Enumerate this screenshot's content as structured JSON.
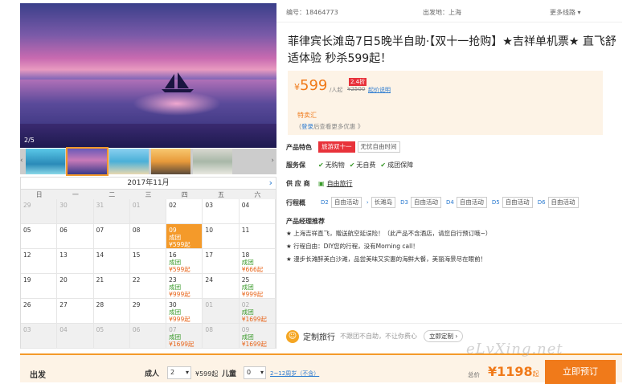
{
  "gallery": {
    "counter": "2/5"
  },
  "calendar": {
    "month": "2017年11月",
    "next": "›",
    "weekdays": [
      "日",
      "一",
      "二",
      "三",
      "四",
      "五",
      "六"
    ],
    "cells": [
      {
        "d": "29",
        "s": "grey"
      },
      {
        "d": "30",
        "s": "grey"
      },
      {
        "d": "31",
        "s": "grey"
      },
      {
        "d": "01",
        "s": "grey"
      },
      {
        "d": "02",
        "s": ""
      },
      {
        "d": "03",
        "s": ""
      },
      {
        "d": "04",
        "s": ""
      },
      {
        "d": "05",
        "s": ""
      },
      {
        "d": "06",
        "s": ""
      },
      {
        "d": "07",
        "s": ""
      },
      {
        "d": "08",
        "s": ""
      },
      {
        "d": "09",
        "s": "sel",
        "g": "成团",
        "p": "¥599起"
      },
      {
        "d": "10",
        "s": ""
      },
      {
        "d": "11",
        "s": ""
      },
      {
        "d": "12",
        "s": ""
      },
      {
        "d": "13",
        "s": ""
      },
      {
        "d": "14",
        "s": ""
      },
      {
        "d": "15",
        "s": ""
      },
      {
        "d": "16",
        "s": "",
        "g": "成团",
        "p": "¥599起"
      },
      {
        "d": "17",
        "s": ""
      },
      {
        "d": "18",
        "s": "",
        "g": "成团",
        "p": "¥666起"
      },
      {
        "d": "19",
        "s": ""
      },
      {
        "d": "20",
        "s": ""
      },
      {
        "d": "21",
        "s": ""
      },
      {
        "d": "22",
        "s": ""
      },
      {
        "d": "23",
        "s": "",
        "g": "成团",
        "p": "¥999起"
      },
      {
        "d": "24",
        "s": ""
      },
      {
        "d": "25",
        "s": "",
        "g": "成团",
        "p": "¥999起"
      },
      {
        "d": "26",
        "s": ""
      },
      {
        "d": "27",
        "s": ""
      },
      {
        "d": "28",
        "s": ""
      },
      {
        "d": "29",
        "s": ""
      },
      {
        "d": "30",
        "s": "",
        "g": "成团",
        "p": "¥999起"
      },
      {
        "d": "01",
        "s": "grey"
      },
      {
        "d": "02",
        "s": "grey",
        "g": "成团",
        "p": "¥1699起"
      },
      {
        "d": "03",
        "s": "grey"
      },
      {
        "d": "04",
        "s": "grey"
      },
      {
        "d": "05",
        "s": "grey"
      },
      {
        "d": "06",
        "s": "grey"
      },
      {
        "d": "07",
        "s": "grey",
        "g": "成团",
        "p": "¥1699起"
      },
      {
        "d": "08",
        "s": "grey"
      },
      {
        "d": "09",
        "s": "grey",
        "g": "成团",
        "p": "¥1699起"
      }
    ]
  },
  "header": {
    "code": "编号：18464773",
    "departure": "出发地：上海",
    "more": "更多线路 ▾"
  },
  "title": "菲律宾长滩岛7日5晚半自助·【双十一抢购】★吉祥单机票★ 直飞舒适体验 秒杀599起！",
  "price": {
    "currency": "¥",
    "value": "599",
    "unit": "/人起",
    "discount": "2.4折",
    "original": "¥2500",
    "explain": "起价说明",
    "special": "特卖汇",
    "login": "登录",
    "login_rest": "后查看更多优惠 》"
  },
  "features": {
    "label": "产品特色",
    "tags": [
      "旅游双十一",
      "无忧自由时间"
    ]
  },
  "guarantee": {
    "label": "服务保",
    "items": [
      "无购物",
      "无自费",
      "成团保障"
    ]
  },
  "supplier": {
    "label": "供 应 商",
    "name": "自由旅行"
  },
  "itinerary": {
    "label": "行程概",
    "days": [
      [
        "D2",
        "自由活动"
      ],
      [
        "",
        "长滩岛"
      ],
      [
        "D3",
        "自由活动"
      ],
      [
        "D4",
        "自由活动"
      ],
      [
        "D5",
        "自由活动"
      ],
      [
        "D6",
        "自由活动"
      ]
    ],
    "first": "自由活动"
  },
  "recommend": {
    "title": "产品经理推荐",
    "lines": [
      "★ 上海吉祥直飞，赠送航空延误险！（此产品不含酒店，请您自行预订哦~）",
      "★ 行程自由：DIY您的行程，没有Morning call！",
      "★ 漫步长滩醉美白沙滩，品尝美味又实惠的海鲜大餐，美丽海景尽在眼前！"
    ]
  },
  "custom": {
    "title": "定制旅行",
    "slogan": "不跟团不自助，不让你费心",
    "button": "立即定制 ›"
  },
  "bottom": {
    "departure": "出发",
    "adult_label": "成人",
    "adult_val": "2",
    "adult_price": "¥599起",
    "child_label": "儿童",
    "child_val": "0",
    "child_note": "2~12周岁（不含）",
    "total_label": "总价",
    "total": "¥1198",
    "total_suffix": "起",
    "book": "立即预订"
  },
  "watermark": "eLvXing.net"
}
